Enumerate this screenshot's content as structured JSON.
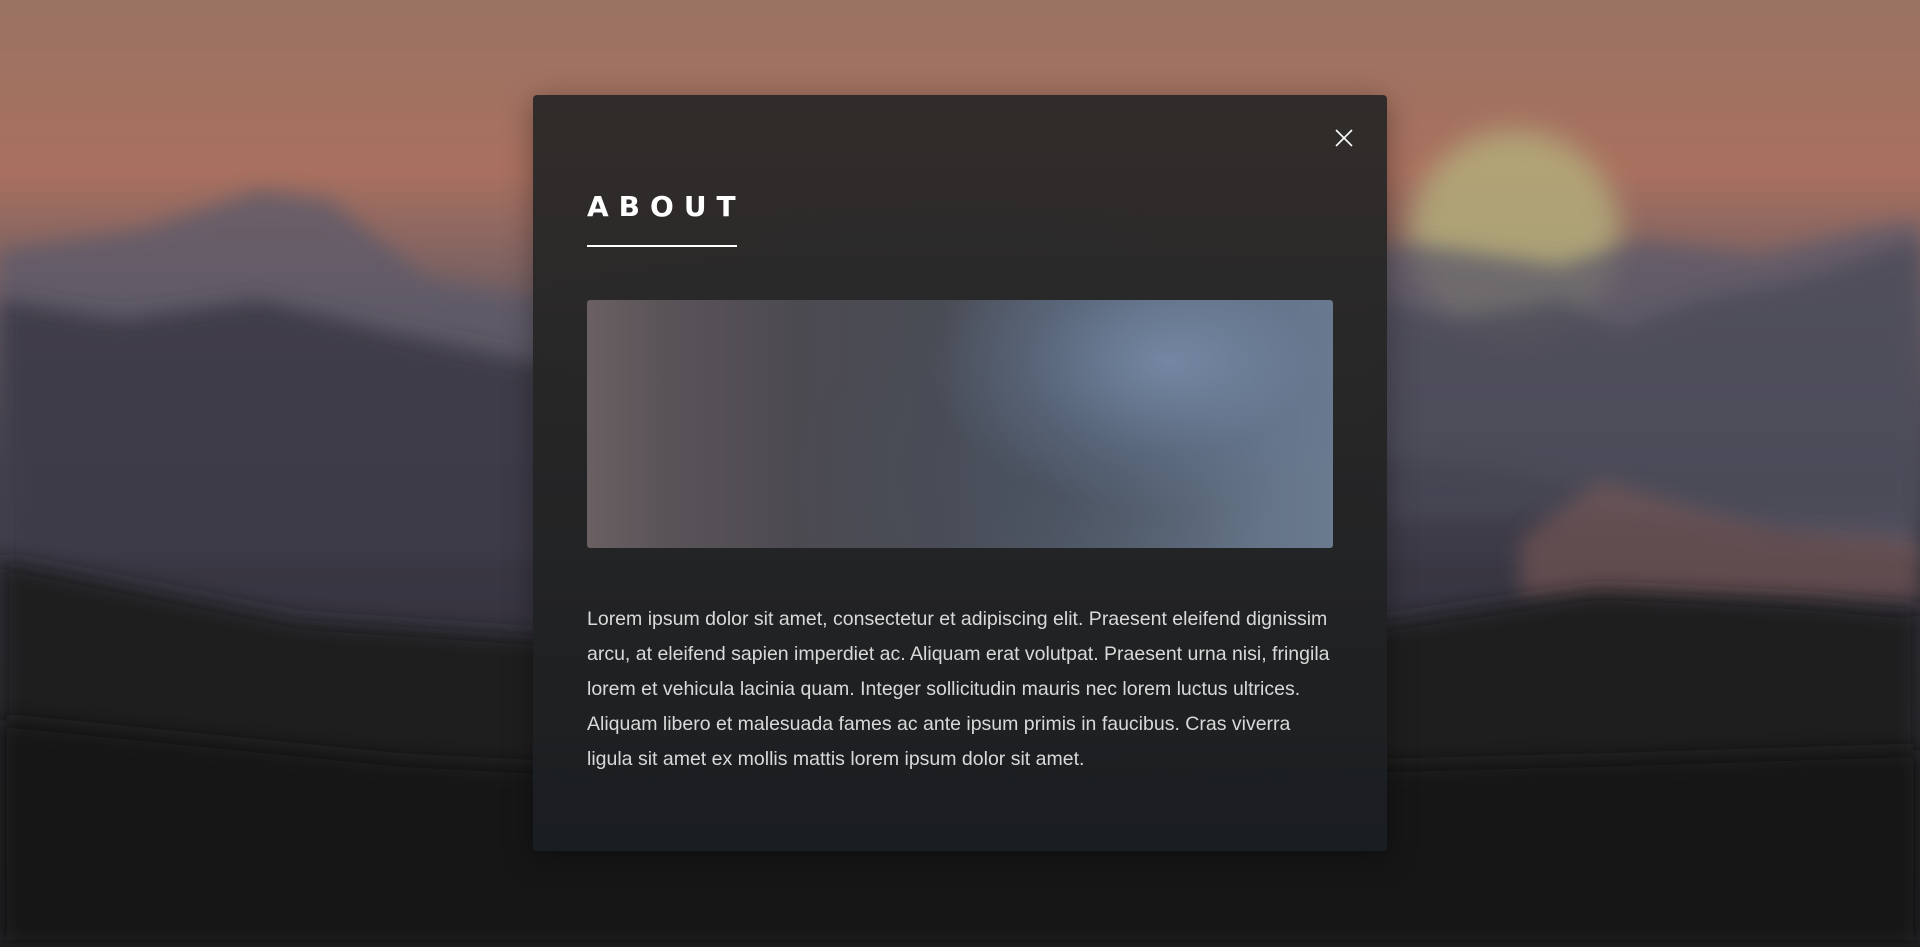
{
  "modal": {
    "title": "ABOUT",
    "close_icon": "close-icon",
    "image_icon": "blurred-landscape-image",
    "body": "Lorem ipsum dolor sit amet, consectetur et adipiscing elit. Praesent eleifend dignissim arcu, at eleifend sapien imperdiet ac. Aliquam erat volutpat. Praesent urna nisi, fringila lorem et vehicula lacinia quam. Integer sollicitudin mauris nec lorem luctus ultrices. Aliquam libero et malesuada fames ac ante ipsum primis in faucibus. Cras viverra ligula sit amet ex mollis mattis lorem ipsum dolor sit amet."
  },
  "colors": {
    "title": "#ffffff",
    "body_text": "#d9d9d9",
    "modal_bg": "#2b2a29",
    "sky": "#a9705f",
    "sun": "#b7ad78"
  }
}
